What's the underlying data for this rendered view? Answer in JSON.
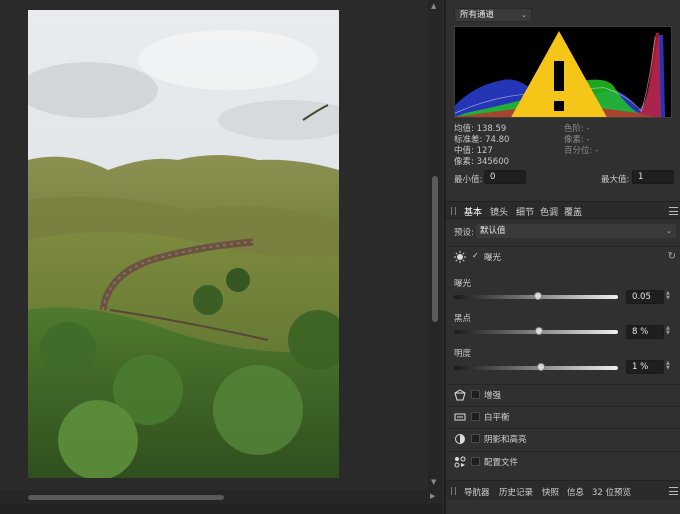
{
  "histogram": {
    "channel": "所有通道",
    "stats_left": [
      "均值: 138.59",
      "标准差: 74.80",
      "中值: 127",
      "像素: 345600"
    ],
    "stats_right": [
      "色阶: -",
      "像素: -",
      "百分位: -"
    ],
    "min_label": "最小值:",
    "min_value": "0",
    "max_label": "最大值:",
    "max_value": "1",
    "warning_color": "#f5c518"
  },
  "tabs": [
    "基本",
    "镜头",
    "细节",
    "色调",
    "覆盖"
  ],
  "preset": {
    "label": "预设:",
    "value": "默认值"
  },
  "exposure_section": {
    "label": "曝光",
    "checked": true
  },
  "sliders": [
    {
      "label": "曝光",
      "value": "0.05",
      "fraction": 0.51
    },
    {
      "label": "黑点",
      "value": "8 %",
      "fraction": 0.52
    },
    {
      "label": "明度",
      "value": "1 %",
      "fraction": 0.53
    }
  ],
  "sections": [
    {
      "label": "增强",
      "icon": "enhance-icon"
    },
    {
      "label": "白平衡",
      "icon": "white-balance-icon"
    },
    {
      "label": "阴影和高亮",
      "icon": "shadows-highlights-icon"
    },
    {
      "label": "配置文件",
      "icon": "profile-icon"
    }
  ],
  "bottom_tabs": [
    "导航器",
    "历史记录",
    "快照",
    "信息",
    "32 位预览"
  ]
}
